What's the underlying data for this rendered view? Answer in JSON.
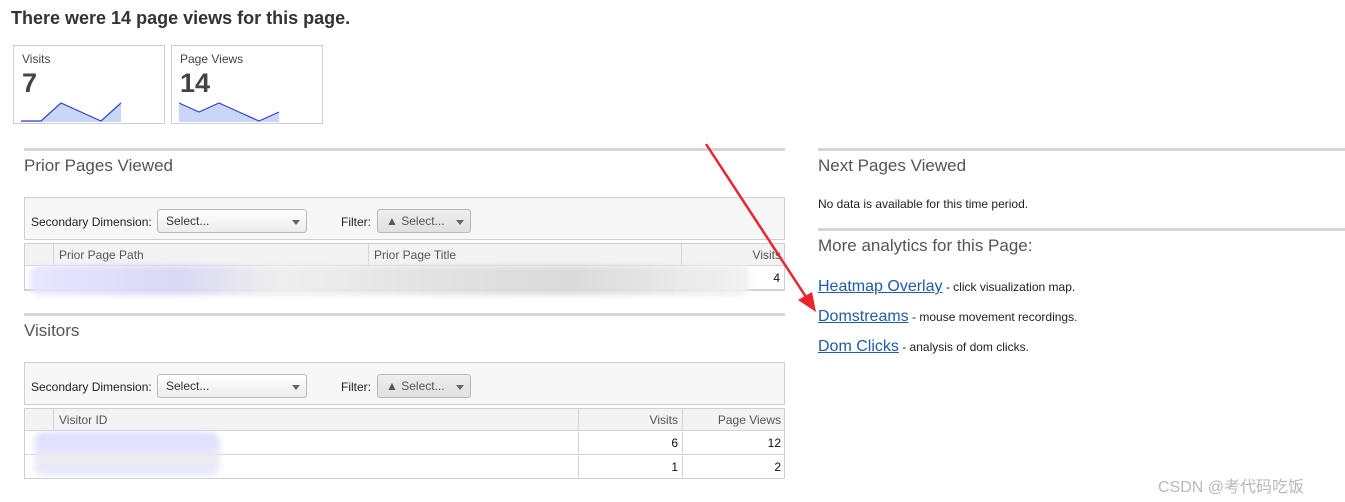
{
  "page_title": "There were 14 page views for this page.",
  "kpis": [
    {
      "label": "Visits",
      "value": "7",
      "spark": [
        1,
        1,
        3,
        2,
        1,
        3
      ]
    },
    {
      "label": "Page Views",
      "value": "14",
      "spark": [
        3,
        2,
        3,
        2,
        1,
        2
      ]
    }
  ],
  "prior_pages": {
    "title": "Prior Pages Viewed",
    "secondary_label": "Secondary Dimension:",
    "secondary_value": "Select...",
    "filter_label": "Filter:",
    "filter_value": "Select...",
    "columns": [
      "Prior Page Path",
      "Prior Page Title",
      "Visits"
    ],
    "rows": [
      {
        "visits": "4"
      }
    ]
  },
  "visitors": {
    "title": "Visitors",
    "secondary_label": "Secondary Dimension:",
    "secondary_value": "Select...",
    "filter_label": "Filter:",
    "filter_value": "Select...",
    "columns": [
      "Visitor ID",
      "Visits",
      "Page Views"
    ],
    "rows": [
      {
        "visits": "6",
        "page_views": "12"
      },
      {
        "visits": "1",
        "page_views": "2"
      }
    ]
  },
  "next_pages": {
    "title": "Next Pages Viewed",
    "empty_text": "No data is available for this time period."
  },
  "more_analytics": {
    "title": "More analytics for this Page:",
    "links": [
      {
        "label": "Heatmap Overlay",
        "desc": " - click visualization map."
      },
      {
        "label": "Domstreams",
        "desc": " - mouse movement recordings."
      },
      {
        "label": "Dom Clicks",
        "desc": " - analysis of dom clicks."
      }
    ]
  },
  "watermark": "CSDN @考代码吃饭",
  "colors": {
    "arrow": "#e8262b",
    "link": "#1f5aa6",
    "spark_line": "#3344cc",
    "spark_fill": "#c9d6f7"
  }
}
